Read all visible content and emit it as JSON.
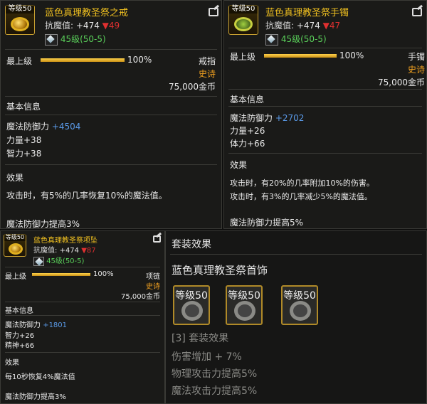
{
  "panels": [
    {
      "lvl": "等级50",
      "name": "蓝色真理教圣祭之戒",
      "resist_label": "抗魔值:",
      "resist_up": "+474",
      "resist_down": "▼49",
      "level_req": "45级(50-5)",
      "grade_label": "最上级",
      "grade_pct": "100%",
      "grade_fill": 1.0,
      "type": "戒指",
      "rarity": "史诗",
      "price": "75,000金币",
      "basic_title": "基本信息",
      "main_stat_label": "魔法防御力",
      "main_stat_val": "+4504",
      "sub_stats": [
        "力量+38",
        "智力+38"
      ],
      "effect_title": "效果",
      "effects": [
        "攻击时，有5%的几率恢复10%的魔法值。"
      ],
      "footer": "魔法防御力提高3%"
    },
    {
      "lvl": "等级50",
      "name": "蓝色真理教圣祭手镯",
      "resist_label": "抗魔值:",
      "resist_up": "+474",
      "resist_down": "▼47",
      "level_req": "45级(50-5)",
      "grade_label": "最上级",
      "grade_pct": "100%",
      "grade_fill": 1.0,
      "type": "手镯",
      "rarity": "史诗",
      "price": "75,000金币",
      "basic_title": "基本信息",
      "main_stat_label": "魔法防御力",
      "main_stat_val": "+2702",
      "sub_stats": [
        "力量+26",
        "体力+66"
      ],
      "effect_title": "效果",
      "effects": [
        "攻击时，有20%的几率附加10%的伤害。",
        "攻击时，有3%的几率减少5%的魔法值。"
      ],
      "footer": "魔法防御力提高5%"
    },
    {
      "lvl": "等级50",
      "name": "蓝色真理教圣祭项坠",
      "resist_label": "抗魔值:",
      "resist_up": "+474",
      "resist_down": "▼87",
      "level_req": "45级(50-5)",
      "grade_label": "最上级",
      "grade_pct": "100%",
      "grade_fill": 1.0,
      "type": "项链",
      "rarity": "史诗",
      "price": "75,000金币",
      "basic_title": "基本信息",
      "main_stat_label": "魔法防御力",
      "main_stat_val": "+1801",
      "sub_stats": [
        "智力+26",
        "精神+66"
      ],
      "effect_title": "效果",
      "effects": [
        "每10秒恢复4%魔法值"
      ],
      "footer": "魔法防御力提高3%"
    }
  ],
  "set": {
    "title": "套装效果",
    "set_name": "蓝色真理教圣祭首饰",
    "slots": [
      {
        "lvl": "等级50",
        "icon": "necklace-icon"
      },
      {
        "lvl": "等级50",
        "icon": "bracelet-icon"
      },
      {
        "lvl": "等级50",
        "icon": "ring-icon"
      }
    ],
    "bonus_header": "[3] 套装效果",
    "bonuses": [
      "伤害增加 + 7%",
      "物理攻击力提高5%",
      "魔法攻击力提高5%"
    ]
  }
}
